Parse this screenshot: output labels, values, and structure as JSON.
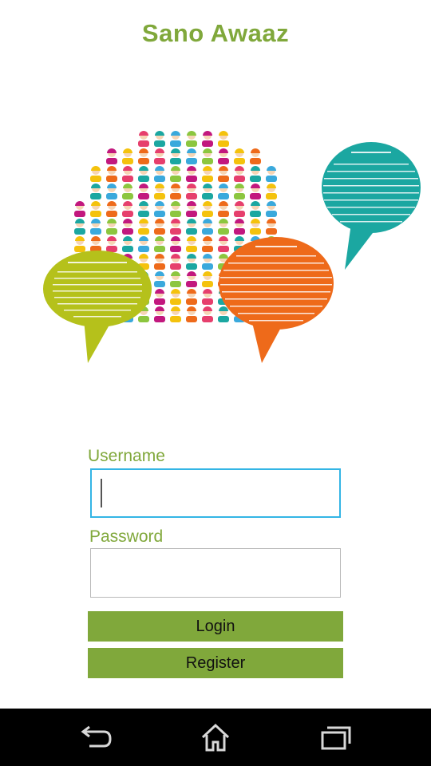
{
  "app": {
    "title": "Sano Awaaz"
  },
  "hero": {
    "icon": "speech-bubbles-crowd-illustration"
  },
  "login_form": {
    "username_label": "Username",
    "username_value": "",
    "password_label": "Password",
    "password_value": "",
    "login_label": "Login",
    "register_label": "Register"
  },
  "navbar": {
    "back_icon": "back-icon",
    "home_icon": "home-icon",
    "recents_icon": "recents-icon"
  },
  "colors": {
    "brand_green": "#80a83b",
    "focus_blue": "#33b5e5"
  }
}
